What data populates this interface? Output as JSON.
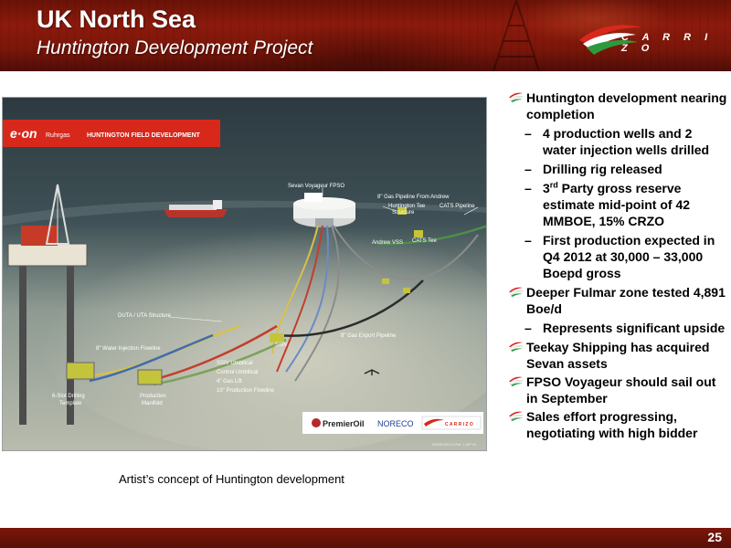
{
  "header": {
    "title": "UK North Sea",
    "subtitle": "Huntington Development Project",
    "logo_text": "C A R R I Z O"
  },
  "scene": {
    "banner_brand": "e·on",
    "banner_sub": "Ruhrgas",
    "banner_title": "HUNTINGTON FIELD DEVELOPMENT",
    "labels": {
      "fpso": "Sevan Voyageur FPSO",
      "gas_pipeline_andrew_1": "8\" Gas Pipeline From Andrew",
      "tee_structure_1": "Huntington Tee",
      "tee_structure_2": "Structure",
      "cats_pipeline": "CATS Pipeline",
      "andrew_vss": "Andrew VSS",
      "cats_tee": "CATS Tee",
      "duta": "DUTA / UTA Structure",
      "water_injection": "8\" Water Injection Flowline",
      "ssiv": "SSIV",
      "gas_export": "8\" Gas Export Pipeline",
      "drilling_template_1": "6-Slot Drilling",
      "drilling_template_2": "Template",
      "production_manifold_1": "Production",
      "production_manifold_2": "Manifold",
      "ssiv_umbilical": "SSIV Umbilical",
      "control_umbilical": "Control Umbilical",
      "gas_lift": "4\" Gas Lift",
      "production_flowline": "10\" Production Flowline"
    },
    "partners": {
      "premier": "PremierOil",
      "noreco": "NORECO",
      "carrizo": "C A R R I Z O"
    },
    "credit": "NOREX/ECO Ref: 1 MP 01"
  },
  "caption": "Artist’s concept of Huntington development",
  "bullets": [
    {
      "text": "Huntington development nearing completion",
      "sub": [
        {
          "text": "4 production wells and 2 water injection wells drilled"
        },
        {
          "text": "Drilling rig released"
        },
        {
          "pre": "3",
          "sup": "rd",
          "text": " Party gross reserve estimate mid-point of 42 MMBOE, 15% CRZO"
        },
        {
          "text": "First production expected in Q4 2012 at 30,000 – 33,000 Boepd gross"
        }
      ]
    },
    {
      "text": "Deeper Fulmar zone tested 4,891 Boe/d",
      "sub": [
        {
          "text": "Represents significant upside"
        }
      ]
    },
    {
      "text": "Teekay Shipping has acquired Sevan assets",
      "sub": []
    },
    {
      "text": "FPSO Voyageur should sail out in September",
      "sub": []
    },
    {
      "text": "Sales effort progressing, negotiating with high bidder",
      "sub": []
    }
  ],
  "footer": {
    "page_number": "25"
  },
  "colors": {
    "header_red": "#8c1a0c",
    "logo_green": "#2e9a3e",
    "logo_red": "#d8281c"
  }
}
